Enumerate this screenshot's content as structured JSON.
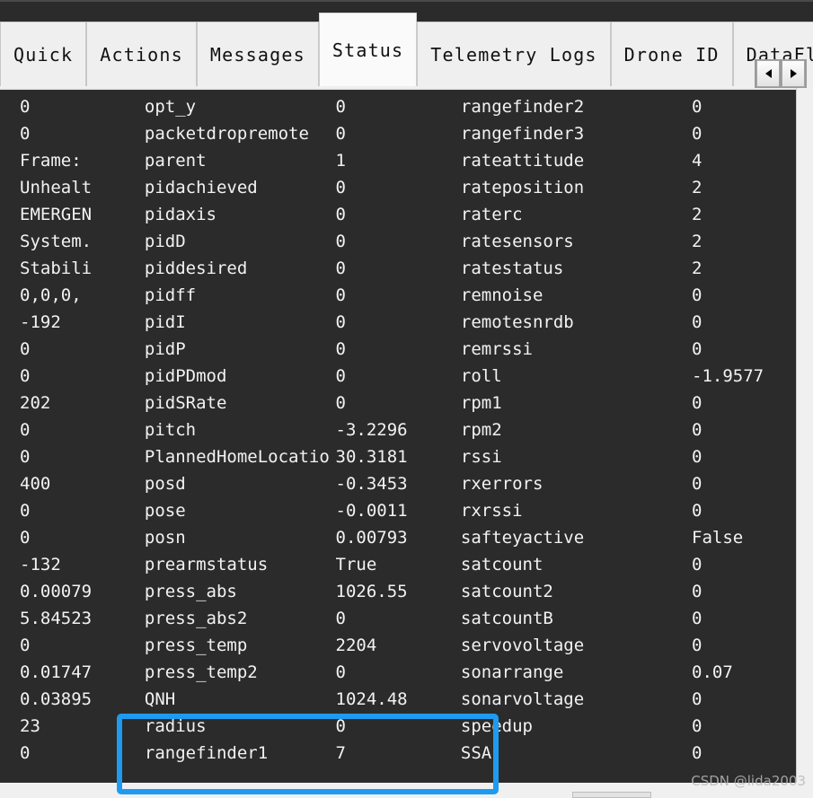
{
  "window": {
    "title": "Mission Planner Status Tab"
  },
  "tabbar": {
    "tabs": [
      {
        "label": "Quick",
        "active": false
      },
      {
        "label": "Actions",
        "active": false
      },
      {
        "label": "Messages",
        "active": false
      },
      {
        "label": "Status",
        "active": true
      },
      {
        "label": "Telemetry Logs",
        "active": false
      },
      {
        "label": "Drone ID",
        "active": false
      },
      {
        "label": "DataFlas",
        "active": false
      }
    ],
    "scroll_left_icon": "triangle-left-icon",
    "scroll_right_icon": "triangle-right-icon"
  },
  "status_grid": {
    "columns": [
      "value_left",
      "key_mid",
      "value_mid",
      "key_right",
      "value_right"
    ],
    "rows": [
      {
        "value_left": "0",
        "key_mid": "opt_y",
        "value_mid": "0",
        "key_right": "rangefinder2",
        "value_right": "0"
      },
      {
        "value_left": "0",
        "key_mid": "packetdropremote",
        "value_mid": "0",
        "key_right": "rangefinder3",
        "value_right": "0"
      },
      {
        "value_left": "Frame:",
        "key_mid": "parent",
        "value_mid": "1",
        "key_right": "rateattitude",
        "value_right": "4"
      },
      {
        "value_left": "Unhealt",
        "key_mid": "pidachieved",
        "value_mid": "0",
        "key_right": "rateposition",
        "value_right": "2"
      },
      {
        "value_left": "EMERGEN",
        "key_mid": "pidaxis",
        "value_mid": "0",
        "key_right": "raterc",
        "value_right": "2"
      },
      {
        "value_left": "System.",
        "key_mid": "pidD",
        "value_mid": "0",
        "key_right": "ratesensors",
        "value_right": "2"
      },
      {
        "value_left": "Stabili",
        "key_mid": "piddesired",
        "value_mid": "0",
        "key_right": "ratestatus",
        "value_right": "2"
      },
      {
        "value_left": "0,0,0,",
        "key_mid": "pidff",
        "value_mid": "0",
        "key_right": "remnoise",
        "value_right": "0"
      },
      {
        "value_left": "-192",
        "key_mid": "pidI",
        "value_mid": "0",
        "key_right": "remotesnrdb",
        "value_right": "0"
      },
      {
        "value_left": "0",
        "key_mid": "pidP",
        "value_mid": "0",
        "key_right": "remrssi",
        "value_right": "0"
      },
      {
        "value_left": "0",
        "key_mid": "pidPDmod",
        "value_mid": "0",
        "key_right": "roll",
        "value_right": "-1.9577"
      },
      {
        "value_left": "202",
        "key_mid": "pidSRate",
        "value_mid": "0",
        "key_right": "rpm1",
        "value_right": "0"
      },
      {
        "value_left": "0",
        "key_mid": "pitch",
        "value_mid": "-3.2296",
        "key_right": "rpm2",
        "value_right": "0"
      },
      {
        "value_left": "0",
        "key_mid": "PlannedHomeLocatio",
        "value_mid": "30.3181",
        "key_right": "rssi",
        "value_right": "0"
      },
      {
        "value_left": "400",
        "key_mid": "posd",
        "value_mid": "-0.3453",
        "key_right": "rxerrors",
        "value_right": "0"
      },
      {
        "value_left": "0",
        "key_mid": "pose",
        "value_mid": "-0.0011",
        "key_right": "rxrssi",
        "value_right": "0"
      },
      {
        "value_left": "0",
        "key_mid": "posn",
        "value_mid": "0.00793",
        "key_right": "safteyactive",
        "value_right": "False"
      },
      {
        "value_left": "-132",
        "key_mid": "prearmstatus",
        "value_mid": "True",
        "key_right": "satcount",
        "value_right": "0"
      },
      {
        "value_left": "0.00079",
        "key_mid": "press_abs",
        "value_mid": "1026.55",
        "key_right": "satcount2",
        "value_right": "0"
      },
      {
        "value_left": "5.84523",
        "key_mid": "press_abs2",
        "value_mid": "0",
        "key_right": "satcountB",
        "value_right": "0"
      },
      {
        "value_left": "0",
        "key_mid": "press_temp",
        "value_mid": "2204",
        "key_right": "servovoltage",
        "value_right": "0"
      },
      {
        "value_left": "0.01747",
        "key_mid": "press_temp2",
        "value_mid": "0",
        "key_right": "sonarrange",
        "value_right": "0.07"
      },
      {
        "value_left": "0.03895",
        "key_mid": "QNH",
        "value_mid": "1024.48",
        "key_right": "sonarvoltage",
        "value_right": "0"
      },
      {
        "value_left": "23",
        "key_mid": "radius",
        "value_mid": "0",
        "key_right": "speedup",
        "value_right": "0"
      },
      {
        "value_left": "0",
        "key_mid": "rangefinder1",
        "value_mid": "7",
        "key_right": "SSA",
        "value_right": "0"
      }
    ]
  },
  "annotation": {
    "highlight_color": "#1e9bf0",
    "highlighted_keys": [
      "radius",
      "rangefinder1"
    ]
  },
  "watermark": {
    "text": "CSDN @lida2003"
  }
}
